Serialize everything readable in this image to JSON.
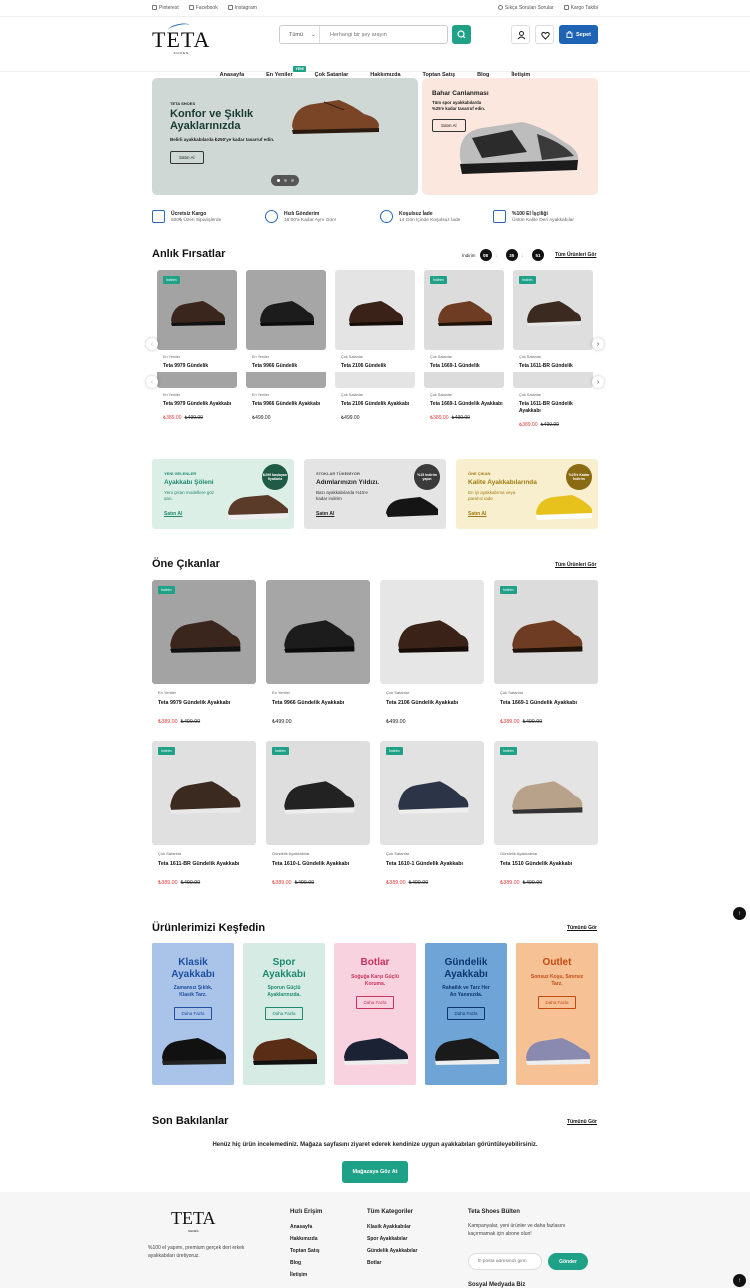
{
  "topbar": {
    "left": [
      "Pinterest",
      "Facebook",
      "Instagram"
    ],
    "right": [
      "Sıkça Sorulan Sorular",
      "Kargo Takibi"
    ]
  },
  "header": {
    "logo": "TETA",
    "logo_sub": "SHOES",
    "search_category": "Tümü",
    "search_placeholder": "Herhangi bir şey arayın",
    "cart_label": "Sepet"
  },
  "nav": {
    "items": [
      "Anasayfa",
      "En Yeniler",
      "Çok Satanlar",
      "Hakkımızda",
      "Toptan Satış",
      "Blog",
      "İletişim"
    ],
    "new_tag": "YENİ"
  },
  "hero": {
    "brand": "TETA SHOES",
    "title_line1": "Konfor ve Şıklık",
    "title_line2": "Ayaklarınızda",
    "desc": "Belirli ayakkabılarda ₺250'ye kadar tasarruf edin.",
    "button": "Satın Al"
  },
  "hero_side": {
    "title": "Bahar Canlanması",
    "desc_line1": "Tüm spor ayakkabılarda",
    "desc_line2": "%25'e kadar tasarruf edin.",
    "button": "Satın Al"
  },
  "features": [
    {
      "title": "Ücretsiz Kargo",
      "desc": "500₺ Üzeri Siparişlerde"
    },
    {
      "title": "Hızlı Gönderim",
      "desc": "16:00'a Kadar Aynı Gün!"
    },
    {
      "title": "Koşulsuz İade",
      "desc": "14 Gün İçinde Koşulsuz İade"
    },
    {
      "title": "%100 El İşçiliği",
      "desc": "Üstün Kalite Deri Ayakkabılar"
    }
  ],
  "flash": {
    "title": "Anlık Fırsatlar",
    "timer_label": "İndirim",
    "timer": [
      "08",
      "35",
      "51"
    ],
    "see_all": "Tüm Ürünleri Gör"
  },
  "flash_products": [
    {
      "cat": "En Yeniler",
      "name": "Teta 9979 Gündelik Ayakkabı",
      "price": "₺389.00",
      "old": "₺499.00",
      "badge": "İndirim"
    },
    {
      "cat": "En Yeniler",
      "name": "Teta 9966 Gündelik Ayakkabı",
      "price": "₺499.00",
      "old": "",
      "badge": ""
    },
    {
      "cat": "Çok Satanlar",
      "name": "Teta 2106 Gündelik Ayakkabı",
      "price": "₺499.00",
      "old": "",
      "badge": ""
    },
    {
      "cat": "Çok Satanlar",
      "name": "Teta 1669-1 Gündelik Ayakkabı",
      "price": "₺389.00",
      "old": "₺499.00",
      "badge": "İndirim"
    },
    {
      "cat": "Çok Satanlar",
      "name": "Teta 1611-BR Gündelik Ayakkabı",
      "price": "₺389.00",
      "old": "₺499.00",
      "badge": "İndirim"
    }
  ],
  "flash_names_short": [
    "Teta 9979 Gündelik",
    "Teta 9966 Gündelik",
    "Teta 2106 Gündelik",
    "Teta 1669-1 Gündelik",
    "Teta 1611-BR Gündelik"
  ],
  "promos": [
    {
      "kicker": "YENİ GELENLER",
      "title": "Ayakkabı Şöleni",
      "desc": "Yeni çıkan modellere göz atın.",
      "link": "Satın Al",
      "circle": "₺299 başlayan fiyatlarla"
    },
    {
      "kicker": "STOKLAR TÜKENİYOR",
      "title": "Adımlarınızın Yıldızı.",
      "desc": "Bazı ayakkabılarda %15'e kadar indirim",
      "link": "Satın Al",
      "circle": "%15 indirim yapın"
    },
    {
      "kicker": "ÖNE ÇIKAN",
      "title": "Kalite Ayakkabılarında",
      "desc": "En iyi ayakkabıma veya paranız iade",
      "link": "Satın Al",
      "circle": "%25'e Kadar İndirim"
    }
  ],
  "featured": {
    "title": "Öne Çıkanlar",
    "see_all": "Tüm Ürünleri Gör"
  },
  "featured_products": [
    {
      "cat": "En Yeniler",
      "name": "Teta 9979 Gündelik Ayakkabı",
      "price": "₺389.00",
      "old": "₺499.00",
      "badge": "İndirim"
    },
    {
      "cat": "En Yeniler",
      "name": "Teta 9966 Gündelik Ayakkabı",
      "price": "₺499.00",
      "old": "",
      "badge": ""
    },
    {
      "cat": "Çok Satanlar",
      "name": "Teta 2106 Gündelik Ayakkabı",
      "price": "₺499.00",
      "old": "",
      "badge": ""
    },
    {
      "cat": "Çok Satanlar",
      "name": "Teta 1669-1 Gündelik Ayakkabı",
      "price": "₺389.00",
      "old": "₺499.00",
      "badge": "İndirim"
    },
    {
      "cat": "Çok Satanlar",
      "name": "Teta 1611-BR Gündelik Ayakkabı",
      "price": "₺389.00",
      "old": "₺499.00",
      "badge": "İndirim"
    },
    {
      "cat": "Gündelik Ayakkabılar",
      "name": "Teta 1610-L Gündelik Ayakkabı",
      "price": "₺389.00",
      "old": "₺499.00",
      "badge": "İndirim"
    },
    {
      "cat": "Çok Satanlar",
      "name": "Teta 1610-1 Gündelik Ayakkabı",
      "price": "₺389.00",
      "old": "₺499.00",
      "badge": "İndirim"
    },
    {
      "cat": "Gündelik Ayakkabılar",
      "name": "Teta 1510 Gündelik Ayakkabı",
      "price": "₺389.00",
      "old": "₺499.00",
      "badge": "İndirim"
    }
  ],
  "explore": {
    "title": "Ürünlerimizi Keşfedin",
    "see_all": "Tümünü Gör",
    "button": "Daha Fazla",
    "items": [
      {
        "t1": "Klasik",
        "t2": "Ayakkabı",
        "desc": "Zamansız Şıklık, Klasik Tarz.",
        "bg": "#a9c4e8",
        "color": "#1f4fa0"
      },
      {
        "t1": "Spor",
        "t2": "Ayakkabı",
        "desc": "Sporun Güçlü Ayaklarınızda.",
        "bg": "#d5ebe4",
        "color": "#1f8a70"
      },
      {
        "t1": "Botlar",
        "t2": "",
        "desc": "Soğuğa Karşı Güçlü Koruma.",
        "bg": "#f8d2de",
        "color": "#c8335f"
      },
      {
        "t1": "Gündelik",
        "t2": "Ayakkabı",
        "desc": "Rahatlık ve Tarz Her An Yanınızda.",
        "bg": "#6fa5d6",
        "color": "#0d3570"
      },
      {
        "t1": "Outlet",
        "t2": "",
        "desc": "Sonsuz Koşu, Sınırsız Tarz.",
        "bg": "#f7c196",
        "color": "#c24a12"
      }
    ]
  },
  "recent": {
    "title": "Son Bakılanlar",
    "see_all": "Tümünü Gör",
    "empty": "Henüz hiç ürün incelemediniz. Mağaza sayfasını ziyaret ederek kendinize uygun ayakkabıları görüntüleyebilirsiniz.",
    "button": "Mağazaya Göz At"
  },
  "footer": {
    "about": "%100 el yapımı, premium gerçek deri erkek ayakkabıları üretiyoruz.",
    "quick_title": "Hızlı Erişim",
    "quick": [
      "Anasayfa",
      "Hakkımızda",
      "Toptan Satış",
      "Blog",
      "İletişim"
    ],
    "cat_title": "Tüm Kategoriler",
    "cats": [
      "Klasik Ayakkabılar",
      "Spor Ayakkabılar",
      "Gündelik Ayakkabılar",
      "Botlar"
    ],
    "news_title": "Teta Shoes Bülten",
    "news_desc": "Kampanyalar, yeni ürünler ve daha fazlasını kaçırmamak için abone olun!",
    "email_placeholder": "E-posta adresinizi girin",
    "subscribe": "Gönder",
    "social_title": "Sosyal Medyada Biz"
  },
  "colors": {
    "green": "#1fa187",
    "blue": "#1f63b4",
    "sale_red": "#e23b3b"
  }
}
